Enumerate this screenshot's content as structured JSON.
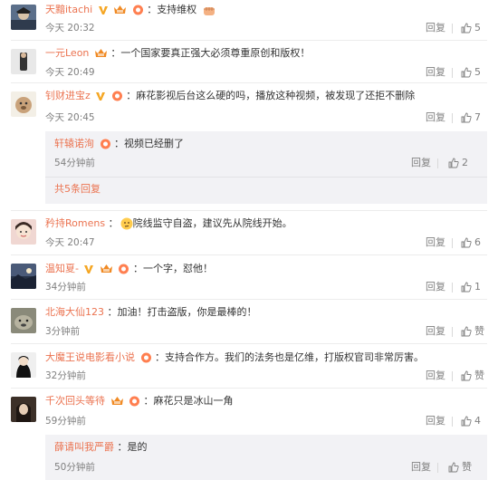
{
  "icons": {
    "verified_color": "#f5a623",
    "vip_color": "#f08a24",
    "fan_badge_color": "#ff7f50",
    "name_color": "#eb7350",
    "reply_color": "#808080"
  },
  "labels": {
    "reply": "回复",
    "like_icon": "thumbs-up-icon"
  },
  "comments": [
    {
      "user": "天黯itachi",
      "colon": "：",
      "content": "支持维权",
      "time": "今天 20:32",
      "likes": "5"
    },
    {
      "user": "一元Leon",
      "colon": "：",
      "content": "一个国家要真正强大必须尊重原创和版权！",
      "time": "今天 20:49",
      "likes": "5"
    },
    {
      "user": "钊财进宝z",
      "colon": "：",
      "content": "麻花影视后台这么硬的吗，播放这种视频，被发现了还拒不删除",
      "time": "今天 20:45",
      "likes": "7",
      "sub": {
        "user": "轩辕诺洵",
        "colon": "：",
        "content": "视频已经删了",
        "time": "54分钟前",
        "likes": "2",
        "more": "共5条回复"
      }
    },
    {
      "user": "矜持Romens",
      "colon": "：",
      "content": "院线监守自盗，建议先从院线开始。",
      "time": "今天 20:47",
      "likes": "6"
    },
    {
      "user": "温知夏-",
      "colon": "：",
      "content": "一个字，怼他！",
      "time": "34分钟前",
      "likes": "1"
    },
    {
      "user": "北海大仙123",
      "colon": "：",
      "content": "加油！打击盗版，你是最棒的！",
      "time": "3分钟前",
      "likes": "赞"
    },
    {
      "user": "大魔王说电影看小说",
      "colon": "：",
      "content": "支持合作方。我们的法务也是亿维，打版权官司非常厉害。",
      "time": "32分钟前",
      "likes": "赞"
    },
    {
      "user": "千次回头等待",
      "colon": "：",
      "content": "麻花只是冰山一角",
      "time": "59分钟前",
      "likes": "4",
      "sub": {
        "user": "薛请叫我严爵",
        "colon": "：",
        "content": "是的",
        "time": "50分钟前",
        "likes": "赞"
      }
    }
  ]
}
